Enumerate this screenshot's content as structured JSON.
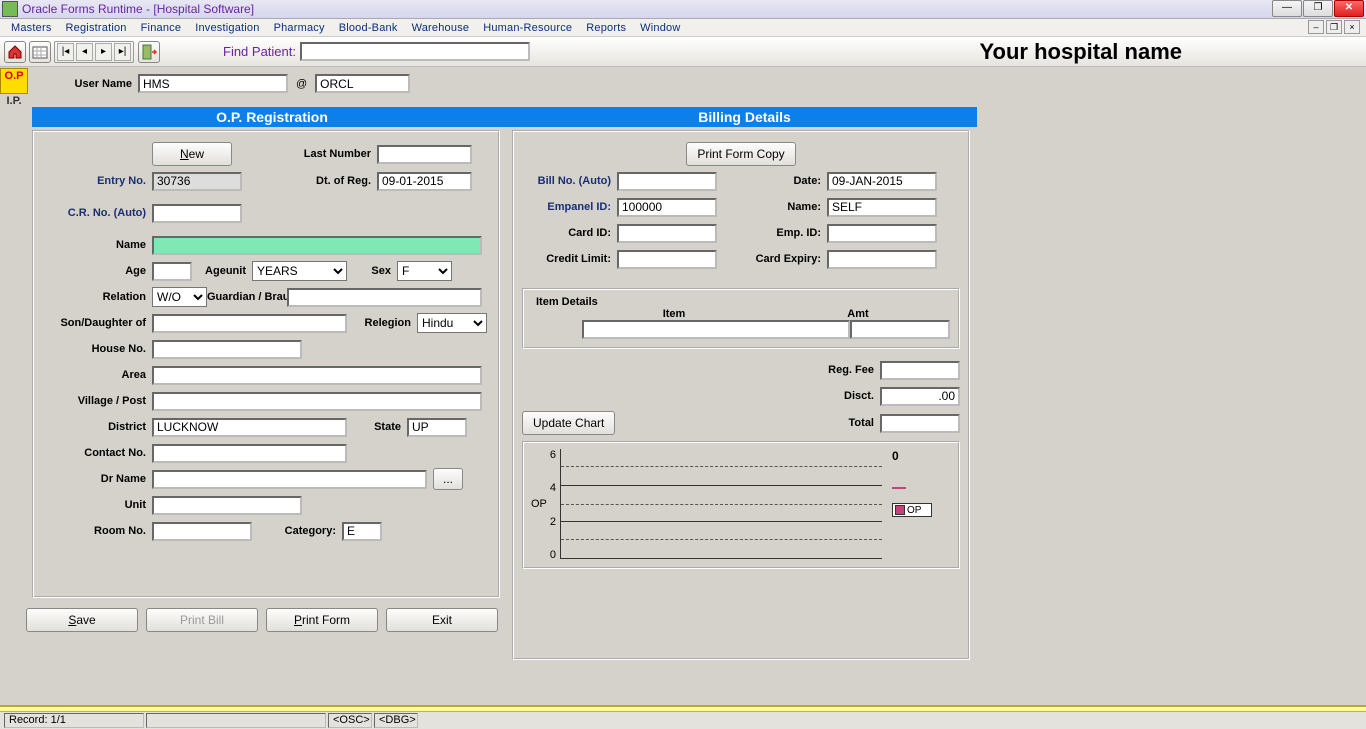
{
  "window": {
    "title": "Oracle Forms Runtime - [Hospital Software]",
    "hospital_name": "Your hospital name"
  },
  "menus": [
    "Masters",
    "Registration",
    "Finance",
    "Investigation",
    "Pharmacy",
    "Blood-Bank",
    "Warehouse",
    "Human-Resource",
    "Reports",
    "Window"
  ],
  "toolbar": {
    "find_patient_label": "Find Patient:"
  },
  "side": {
    "op": "O.P",
    "ip": "I.P."
  },
  "user": {
    "label": "User Name",
    "name": "HMS",
    "at": "@",
    "db": "ORCL"
  },
  "headers": {
    "left": "O.P. Registration",
    "right": "Billing Details"
  },
  "buttons": {
    "new": "New",
    "print_form_copy": "Print Form Copy",
    "update_chart": "Update Chart",
    "save": "Save",
    "print_bill": "Print Bill",
    "print_form": "Print Form",
    "exit": "Exit",
    "browse": "..."
  },
  "reg": {
    "last_number_lbl": "Last Number",
    "entry_no_lbl": "Entry No.",
    "entry_no": "30736",
    "dt_of_reg_lbl": "Dt. of Reg.",
    "dt_of_reg": "09-01-2015",
    "cr_no_lbl": "C.R. No. (Auto)",
    "name_lbl": "Name",
    "age_lbl": "Age",
    "ageunit_lbl": "Ageunit",
    "ageunit": "YEARS",
    "sex_lbl": "Sex",
    "sex": "F",
    "relation_lbl": "Relation",
    "relation": "W/O",
    "guardian_lbl": "Guardian / Braught By:",
    "sondau_lbl": "Son/Daughter of",
    "religion_lbl": "Relegion",
    "religion": "Hindu",
    "house_lbl": "House No.",
    "area_lbl": "Area",
    "village_lbl": "Village / Post",
    "district_lbl": "District",
    "district": "LUCKNOW",
    "state_lbl": "State",
    "state": "UP",
    "contact_lbl": "Contact No.",
    "dr_lbl": "Dr Name",
    "unit_lbl": "Unit",
    "room_lbl": "Room No.",
    "category_lbl": "Category:",
    "category": "E"
  },
  "bill": {
    "billno_lbl": "Bill No. (Auto)",
    "date_lbl": "Date:",
    "date": "09-JAN-2015",
    "empanel_lbl": "Empanel ID:",
    "empanel": "100000",
    "name_lbl": "Name:",
    "name": "SELF",
    "card_lbl": "Card ID:",
    "emp_lbl": "Emp. ID:",
    "credit_lbl": "Credit Limit:",
    "expiry_lbl": "Card Expiry:",
    "item_details": "Item Details",
    "item_lbl": "Item",
    "amt_lbl": "Amt",
    "regfee_lbl": "Reg. Fee",
    "disct_lbl": "Disct.",
    "disct": ".00",
    "total_lbl": "Total"
  },
  "chart_data": {
    "type": "bar",
    "categories": [],
    "values": [],
    "ylabel": "OP",
    "ylim": [
      0,
      6
    ],
    "yticks": [
      0,
      2,
      4,
      6
    ],
    "legend": [
      "OP"
    ],
    "legend_value": "0"
  },
  "status": {
    "record": "Record: 1/1",
    "osc": "<OSC>",
    "dbg": "<DBG>"
  }
}
